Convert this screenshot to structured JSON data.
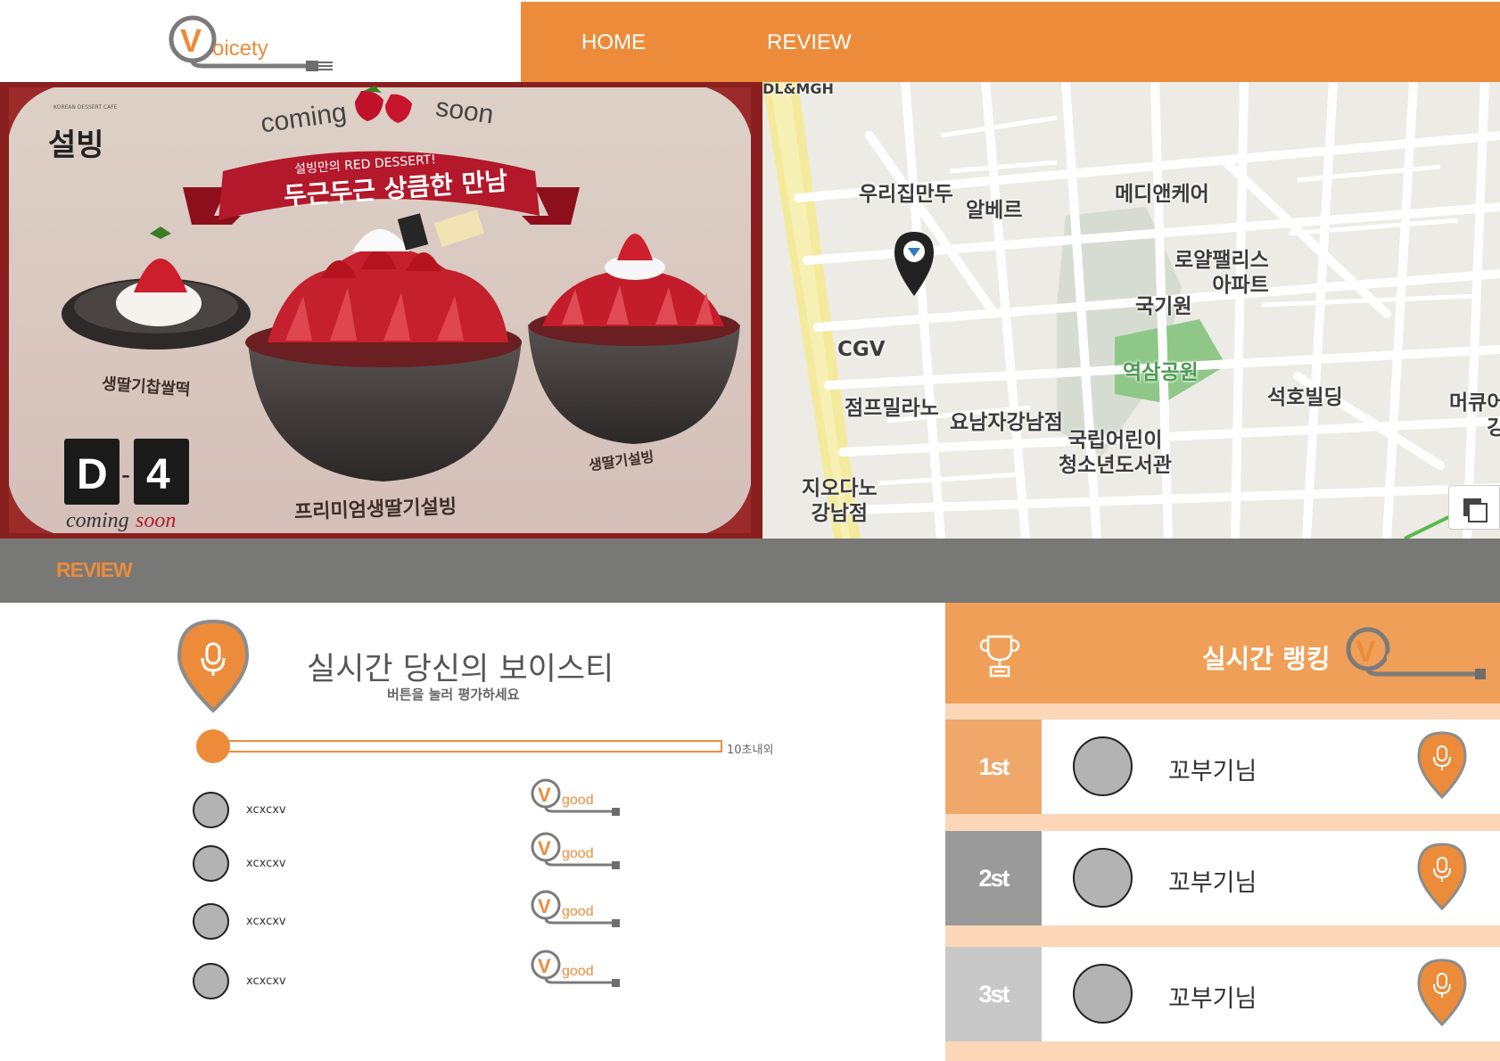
{
  "brand": {
    "logo_text": "oicety",
    "logo_letter": "V",
    "accent": "#ec8c3b"
  },
  "nav": {
    "home": "HOME",
    "review": "REVIEW"
  },
  "promo": {
    "brand_small": "KOREAN DESSERT CAFE",
    "brand": "설빙",
    "coming": "coming",
    "soon": "soon",
    "ribbon_small": "설빙만의 RED DESSERT!",
    "ribbon_main": "두근두근 상큼한 만남",
    "dday_d": "D",
    "dday_dash": "-",
    "dday_n": "4",
    "dday_caption_1": "coming",
    "dday_caption_2": "soon",
    "item_left": "생딸기찹쌀떡",
    "item_center": "프리미엄생딸기설빙",
    "item_right": "생딸기설빙"
  },
  "map": {
    "labels": {
      "top": "DL&MGH",
      "dumpling": "우리집만두",
      "cafe": "알베르",
      "clinic": "메디앤케어",
      "apt": "로얄팰리스\n아파트",
      "gukgi": "국기원",
      "cgv": "CGV",
      "park": "역삼공원",
      "bldg": "석호빌딩",
      "jump": "점프밀라노",
      "yonam": "요남자강남점",
      "library": "국립어린이\n청소년도서관",
      "cure": "머큐어\n강",
      "giodano": "지오다노\n강남점"
    }
  },
  "review_bar": {
    "title": "REVIEW"
  },
  "voice": {
    "title": "실시간 당신의 보이스티",
    "subtitle": "버튼을 눌러 평가하세요",
    "limit": "10초내외",
    "progress": 0,
    "rows": [
      {
        "name": "xcxcxv",
        "rating": "good"
      },
      {
        "name": "xcxcxv",
        "rating": "good"
      },
      {
        "name": "xcxcxv",
        "rating": "good"
      },
      {
        "name": "xcxcxv",
        "rating": "good"
      }
    ]
  },
  "ranking": {
    "title": "실시간 랭킹",
    "logo_text": "oicety",
    "rows": [
      {
        "rank": "1st",
        "name": "꼬부기님",
        "color": "#efa869"
      },
      {
        "rank": "2st",
        "name": "꼬부기님",
        "color": "#9a9a9a"
      },
      {
        "rank": "3st",
        "name": "꼬부기님",
        "color": "#c8c8c8"
      }
    ]
  },
  "icons": {
    "mic": "mic-icon",
    "trophy": "trophy-icon",
    "map_pin": "map-pin-icon",
    "fork": "fork-icon"
  }
}
